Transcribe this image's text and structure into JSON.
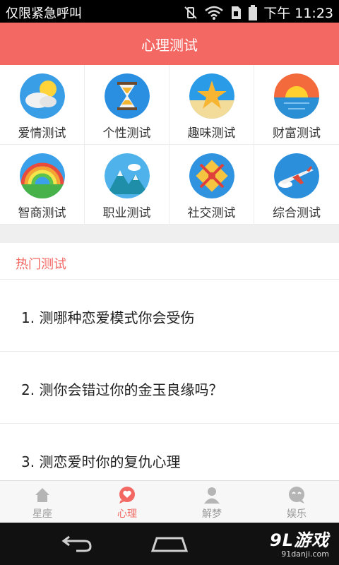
{
  "status_bar": {
    "carrier": "仅限紧急呼叫",
    "time": "下午 11:23"
  },
  "header": {
    "title": "心理测试"
  },
  "categories": [
    {
      "label": "爱情测试",
      "icon": "cloud-sun-icon"
    },
    {
      "label": "个性测试",
      "icon": "hourglass-icon"
    },
    {
      "label": "趣味测试",
      "icon": "starfish-icon"
    },
    {
      "label": "财富测试",
      "icon": "sunset-icon"
    },
    {
      "label": "智商测试",
      "icon": "rainbow-icon"
    },
    {
      "label": "职业测试",
      "icon": "mountain-icon"
    },
    {
      "label": "社交测试",
      "icon": "gift-icon"
    },
    {
      "label": "综合测试",
      "icon": "airplane-icon"
    }
  ],
  "hot": {
    "title": "热门测试",
    "items": [
      "1. 测哪种恋爱模式你会受伤",
      "2. 测你会错过你的金玉良缘吗？",
      "3. 测恋爱时你的复仇心理"
    ]
  },
  "tabs": [
    {
      "label": "星座",
      "icon": "house-icon",
      "active": false
    },
    {
      "label": "心理",
      "icon": "heart-bubble-icon",
      "active": true
    },
    {
      "label": "解梦",
      "icon": "person-icon",
      "active": false
    },
    {
      "label": "娱乐",
      "icon": "smiley-bubble-icon",
      "active": false
    }
  ],
  "colors": {
    "accent": "#f36863",
    "tab_inactive": "#999999"
  },
  "watermark": {
    "brand": "9L游戏",
    "url": "91danji.com"
  }
}
